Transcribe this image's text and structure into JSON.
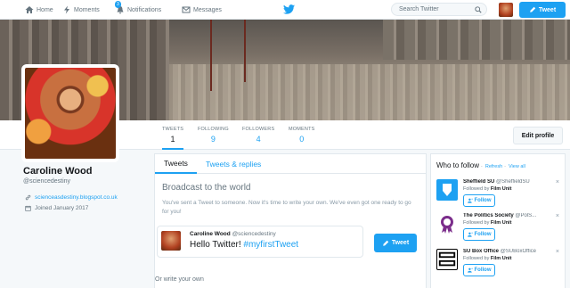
{
  "nav": {
    "home": "Home",
    "moments": "Moments",
    "notifications": "Notifications",
    "notifications_count": "3",
    "messages": "Messages",
    "search_placeholder": "Search Twitter",
    "tweet_button": "Tweet"
  },
  "profile": {
    "name": "Caroline Wood",
    "handle": "@sciencedestiny",
    "website": "scienceasdestiny.blogspot.co.uk",
    "joined": "Joined January 2017",
    "edit_button": "Edit profile"
  },
  "stats": [
    {
      "label": "TWEETS",
      "value": "1"
    },
    {
      "label": "FOLLOWING",
      "value": "9"
    },
    {
      "label": "FOLLOWERS",
      "value": "4"
    },
    {
      "label": "MOMENTS",
      "value": "0"
    }
  ],
  "timeline": {
    "tabs": [
      "Tweets",
      "Tweets & replies"
    ],
    "heading": "Broadcast to the world",
    "description": "You've sent a Tweet to someone. Now it's time to write your own. We've even got one ready to go for you!",
    "card": {
      "name": "Caroline Wood",
      "handle": "@sciencedestiny",
      "text": "Hello Twitter!",
      "hashtag": "#myfirstTweet",
      "button": "Tweet"
    },
    "or_write": "Or write your own"
  },
  "who_to_follow": {
    "title": "Who to follow",
    "refresh": "Refresh",
    "view_all": "View all",
    "follow_label": "Follow",
    "suggestions": [
      {
        "name": "Sheffield SU",
        "handle": "@SheffieldSU",
        "followed_prefix": "Followed by",
        "followed_by": "Film Unit",
        "avatar_color": "#1da1f2"
      },
      {
        "name": "The Politics Society",
        "handle": "@PolS...",
        "followed_prefix": "Followed by",
        "followed_by": "Film Unit",
        "avatar_color": "#7b2d8b"
      },
      {
        "name": "SU Box Office",
        "handle": "@SUBoxOffice",
        "followed_prefix": "Followed by",
        "followed_by": "Film Unit",
        "avatar_color": "#000000"
      }
    ]
  },
  "colors": {
    "accent": "#1da1f2",
    "background": "#f5f8fa"
  }
}
